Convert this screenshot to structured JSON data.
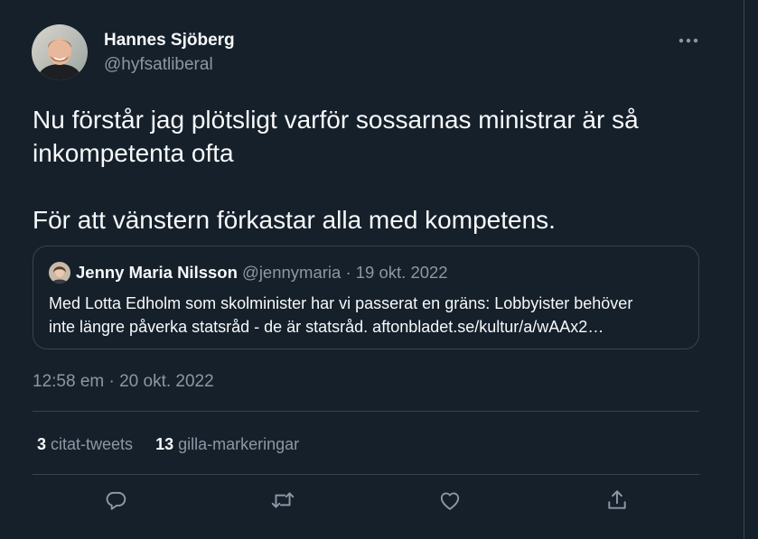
{
  "author": {
    "display_name": "Hannes Sjöberg",
    "handle": "@hyfsatliberal"
  },
  "tweet": {
    "lines": [
      "Nu förstår jag plötsligt varför sossarnas ministrar är så",
      "inkompetenta ofta",
      "För att vänstern förkastar alla med kompetens."
    ],
    "timestamp": "12:58 em · 20 okt. 2022"
  },
  "quote": {
    "display_name": "Jenny Maria Nilsson",
    "handle": "@jennymaria",
    "separator": "·",
    "date": "19 okt. 2022",
    "text_line_1": "Med Lotta Edholm som skolminister har vi passerat en gräns: Lobbyister behöver",
    "text_line_2": "inte längre påverka statsråd - de är statsråd. aftonbladet.se/kultur/a/wAAx2…"
  },
  "stats": {
    "quote_tweets_count": "3",
    "quote_tweets_label": "citat-tweets",
    "likes_count": "13",
    "likes_label": "gilla-markeringar"
  },
  "icons": {
    "more": "more-horizontal-icon",
    "reply": "reply-icon",
    "retweet": "retweet-icon",
    "like": "heart-icon",
    "share": "share-icon"
  },
  "colors": {
    "background": "#15202b",
    "text_primary": "#f7f9f9",
    "text_secondary": "#8b98a5",
    "border": "#38444d"
  }
}
